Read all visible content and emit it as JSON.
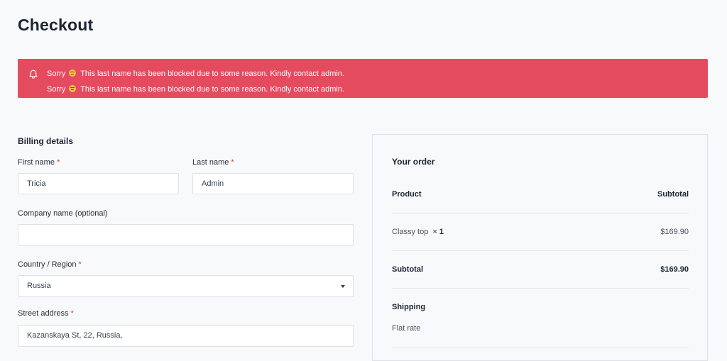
{
  "page": {
    "title": "Checkout"
  },
  "notice": {
    "color": "#e54b5f",
    "icon": "bell-icon",
    "messages": [
      {
        "prefix": "Sorry",
        "suffix": "This last name has been blocked due to some reason. Kindly contact admin."
      },
      {
        "prefix": "Sorry",
        "suffix": "This last name has been blocked due to some reason. Kindly contact admin."
      }
    ]
  },
  "billing": {
    "title": "Billing details",
    "required_mark": "*",
    "first_name": {
      "label": "First name",
      "value": "Tricia"
    },
    "last_name": {
      "label": "Last name",
      "value": "Admin"
    },
    "company": {
      "label": "Company name (optional)",
      "value": ""
    },
    "country": {
      "label": "Country / Region",
      "value": "Russia"
    },
    "street": {
      "label": "Street address",
      "value": "Kazanskaya St, 22, Russia,"
    }
  },
  "order": {
    "title": "Your order",
    "header": {
      "product": "Product",
      "subtotal": "Subtotal"
    },
    "items": [
      {
        "name": "Classy top",
        "qty_symbol": "×",
        "qty": "1",
        "price": "$169.90"
      }
    ],
    "subtotal": {
      "label": "Subtotal",
      "value": "$169.90"
    },
    "shipping": {
      "label": "Shipping",
      "method": "Flat rate"
    }
  }
}
